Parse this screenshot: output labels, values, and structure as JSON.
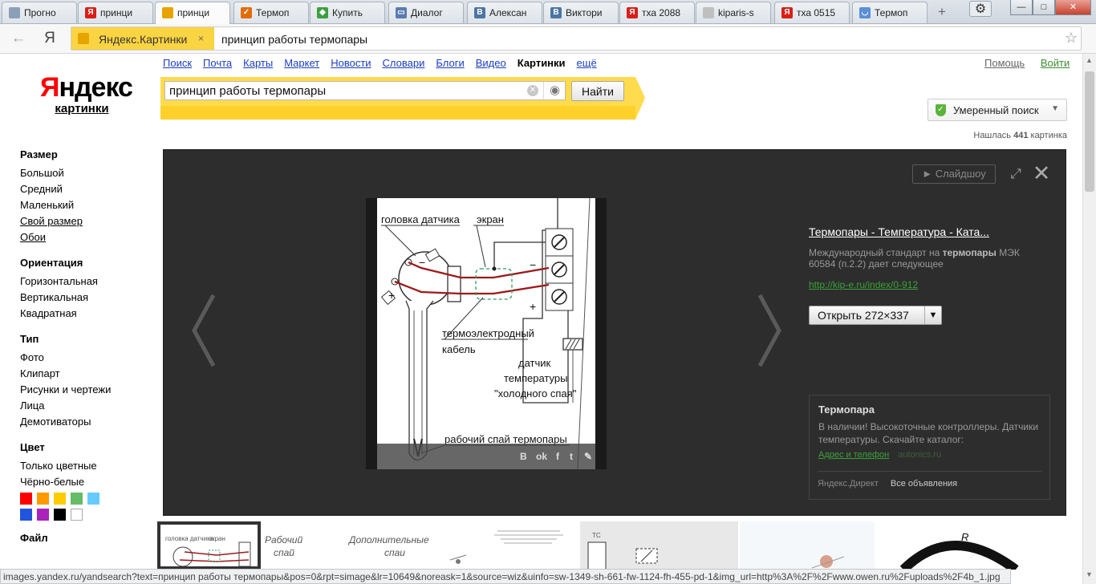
{
  "tabs": [
    {
      "label": "Прогно",
      "icon": "globe-icon",
      "color": "#8aa0b8",
      "glyph": ""
    },
    {
      "label": "принци",
      "icon": "yandex-icon",
      "color": "#d91e18",
      "glyph": "Я"
    },
    {
      "label": "принци",
      "icon": "yandex-images-icon",
      "color": "#e7a400",
      "glyph": "",
      "active": true
    },
    {
      "label": "Термоп",
      "icon": "checkbox-site-icon",
      "color": "#e36c0a",
      "glyph": "✓"
    },
    {
      "label": "Купить",
      "icon": "colorful-site-icon",
      "color": "#3c9f40",
      "glyph": "◆"
    },
    {
      "label": "Диалог",
      "icon": "dialog-icon",
      "color": "#5a7bb0",
      "glyph": "▭"
    },
    {
      "label": "Алексан",
      "icon": "vk-icon",
      "color": "#4c75a3",
      "glyph": "B"
    },
    {
      "label": "Виктори",
      "icon": "vk-icon",
      "color": "#4c75a3",
      "glyph": "B"
    },
    {
      "label": "тха 2088",
      "icon": "yandex-icon",
      "color": "#d91e18",
      "glyph": "Я"
    },
    {
      "label": "kiparis-s",
      "icon": "document-icon",
      "color": "#bfbfbf",
      "glyph": ""
    },
    {
      "label": "тха 0515",
      "icon": "yandex-icon",
      "color": "#d91e18",
      "glyph": "Я"
    },
    {
      "label": "Термоп",
      "icon": "loading-icon",
      "color": "#5b8fd9",
      "glyph": "◡"
    }
  ],
  "window": {
    "minimize": "—",
    "maximize": "□",
    "close": "✕",
    "settings_icon": "⚙",
    "new_tab": "+"
  },
  "addressbar": {
    "back_icon": "←",
    "logo": "Я",
    "badge_label": "Яндекс.Картинки",
    "badge_close": "×",
    "query": "принцип работы термопары",
    "bookmark_icon": "☆"
  },
  "brand": {
    "logo_red": "Я",
    "logo_black": "ндекс",
    "subtitle": "картинки"
  },
  "nav": {
    "links": [
      "Поиск",
      "Почта",
      "Карты",
      "Маркет",
      "Новости",
      "Словари",
      "Блоги",
      "Видео"
    ],
    "current": "Картинки",
    "more": "ещё",
    "help": "Помощь",
    "login": "Войти"
  },
  "search": {
    "value": "принцип работы термопары",
    "button": "Найти"
  },
  "safe_search": {
    "label": "Умеренный поиск"
  },
  "found": {
    "prefix": "Нашлась ",
    "count": "441",
    "suffix": " картинка"
  },
  "filters": [
    {
      "title": "Размер",
      "items": [
        "Большой",
        "Средний",
        "Маленький",
        "Свой размер",
        "Обои"
      ],
      "underlined": [
        "Свой размер",
        "Обои"
      ]
    },
    {
      "title": "Ориентация",
      "items": [
        "Горизонтальная",
        "Вертикальная",
        "Квадратная"
      ],
      "underlined": []
    },
    {
      "title": "Тип",
      "items": [
        "Фото",
        "Клипарт",
        "Рисунки и чертежи",
        "Лица",
        "Демотиваторы"
      ],
      "underlined": []
    },
    {
      "title": "Цвет",
      "items": [
        "Только цветные",
        "Чёрно-белые"
      ],
      "underlined": []
    },
    {
      "title": "Файл",
      "items": [],
      "underlined": []
    }
  ],
  "colors": [
    "#ff0000",
    "#ff9900",
    "#ffcc00",
    "#66bb66",
    "#66ccff",
    "#2255dd",
    "#aa22bb",
    "#000000",
    "#ffffff"
  ],
  "viewer": {
    "slideshow": "► Слайдшоу",
    "title": "Термопары - Температура - Ката...",
    "desc_before": "Международный стандарт на ",
    "desc_bold": "термопары",
    "desc_after": " МЭК 60584 (п.2.2) дает следующее",
    "url": "http://kip-e.ru/index/0-912",
    "open_label": "Открыть 272×337",
    "share_icons": [
      "В",
      "ok",
      "f",
      "t",
      "✎"
    ]
  },
  "diagram": {
    "head_label": "головка датчика",
    "screen_label": "экран",
    "minus1": "−",
    "plus1": "+",
    "minus2": "−",
    "plus2": "+",
    "cable1": "термоэлектродный",
    "cable2": "кабель",
    "sensor1": "датчик",
    "sensor2": "температуры",
    "sensor3": "\"холодного спая\"",
    "junction": "рабочий спай термопары"
  },
  "ad": {
    "title": "Термопара",
    "text": "В наличии! Высокоточные контроллеры. Датчики температуры. Скачайте каталог:",
    "link": "Адрес и телефон",
    "domain": "autonics.ru",
    "footer_left": "Яндекс.Директ",
    "footer_right": "Все объявления"
  },
  "thumbs": [
    {
      "labels": [
        "головка датчика",
        "экран"
      ]
    },
    {
      "labels": [
        "Рабочий",
        "спай"
      ]
    },
    {
      "labels": [
        "Дополнительные",
        "спаи"
      ]
    },
    {
      "labels": [
        ""
      ]
    },
    {
      "labels": [
        "ТС"
      ]
    },
    {
      "labels": [
        ""
      ]
    },
    {
      "labels": [
        "R"
      ]
    }
  ],
  "statusbar": "images.yandex.ru/yandsearch?text=принцип работы термопары&pos=0&rpt=simage&lr=10649&noreask=1&source=wiz&uinfo=sw-1349-sh-661-fw-1124-fh-455-pd-1&img_url=http%3A%2F%2Fwww.owen.ru%2Fuploads%2F4b_1.jpg"
}
